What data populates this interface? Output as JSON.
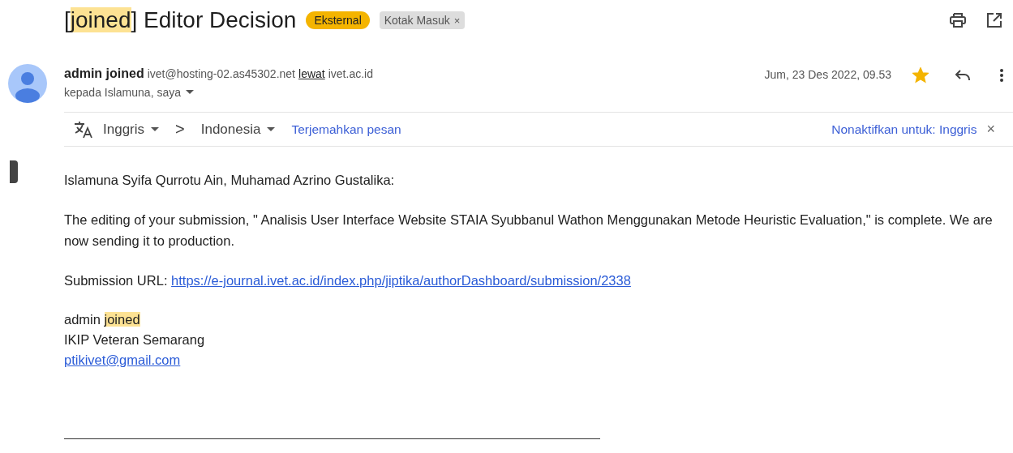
{
  "subject": {
    "parts": [
      {
        "text": "[",
        "highlighted": false
      },
      {
        "text": "joined",
        "highlighted": true
      },
      {
        "text": "] Editor Decision",
        "highlighted": false
      }
    ],
    "labels": [
      {
        "text": "Eksternal",
        "kind": "external"
      },
      {
        "text": "Kotak Masuk",
        "kind": "inbox",
        "close": "×"
      }
    ]
  },
  "sender": {
    "name": "admin joined",
    "email": "ivet@hosting-02.as45302.net",
    "via_label": "lewat",
    "via_domain": "ivet.ac.id",
    "recipients": "kepada Islamuna, saya",
    "date": "Jum, 23 Des 2022, 09.53",
    "starred": true
  },
  "translate_bar": {
    "source_language": "Inggris",
    "separator": ">",
    "target_language": "Indonesia",
    "action": "Terjemahkan pesan",
    "disable": "Nonaktifkan untuk: Inggris",
    "close": "×"
  },
  "body": {
    "greeting": "Islamuna Syifa Qurrotu Ain, Muhamad Azrino Gustalika:",
    "paragraph": "The editing of your submission, \" Analisis User Interface Website STAIA Syubbanul Wathon Menggunakan Metode Heuristic Evaluation,\" is complete. We are now sending it to production.",
    "url_label": "Submission URL:",
    "url": "https://e-journal.ivet.ac.id/index.php/jiptika/authorDashboard/submission/2338",
    "signature": [
      {
        "parts": [
          {
            "text": "admin ",
            "highlighted": false
          },
          {
            "text": "joined",
            "highlighted": true
          }
        ],
        "kind": "text"
      },
      {
        "parts": [
          {
            "text": "IKIP Veteran Semarang",
            "highlighted": false
          }
        ],
        "kind": "text"
      },
      {
        "parts": [
          {
            "text": "ptikivet@gmail.com",
            "highlighted": false
          }
        ],
        "kind": "link"
      }
    ]
  }
}
